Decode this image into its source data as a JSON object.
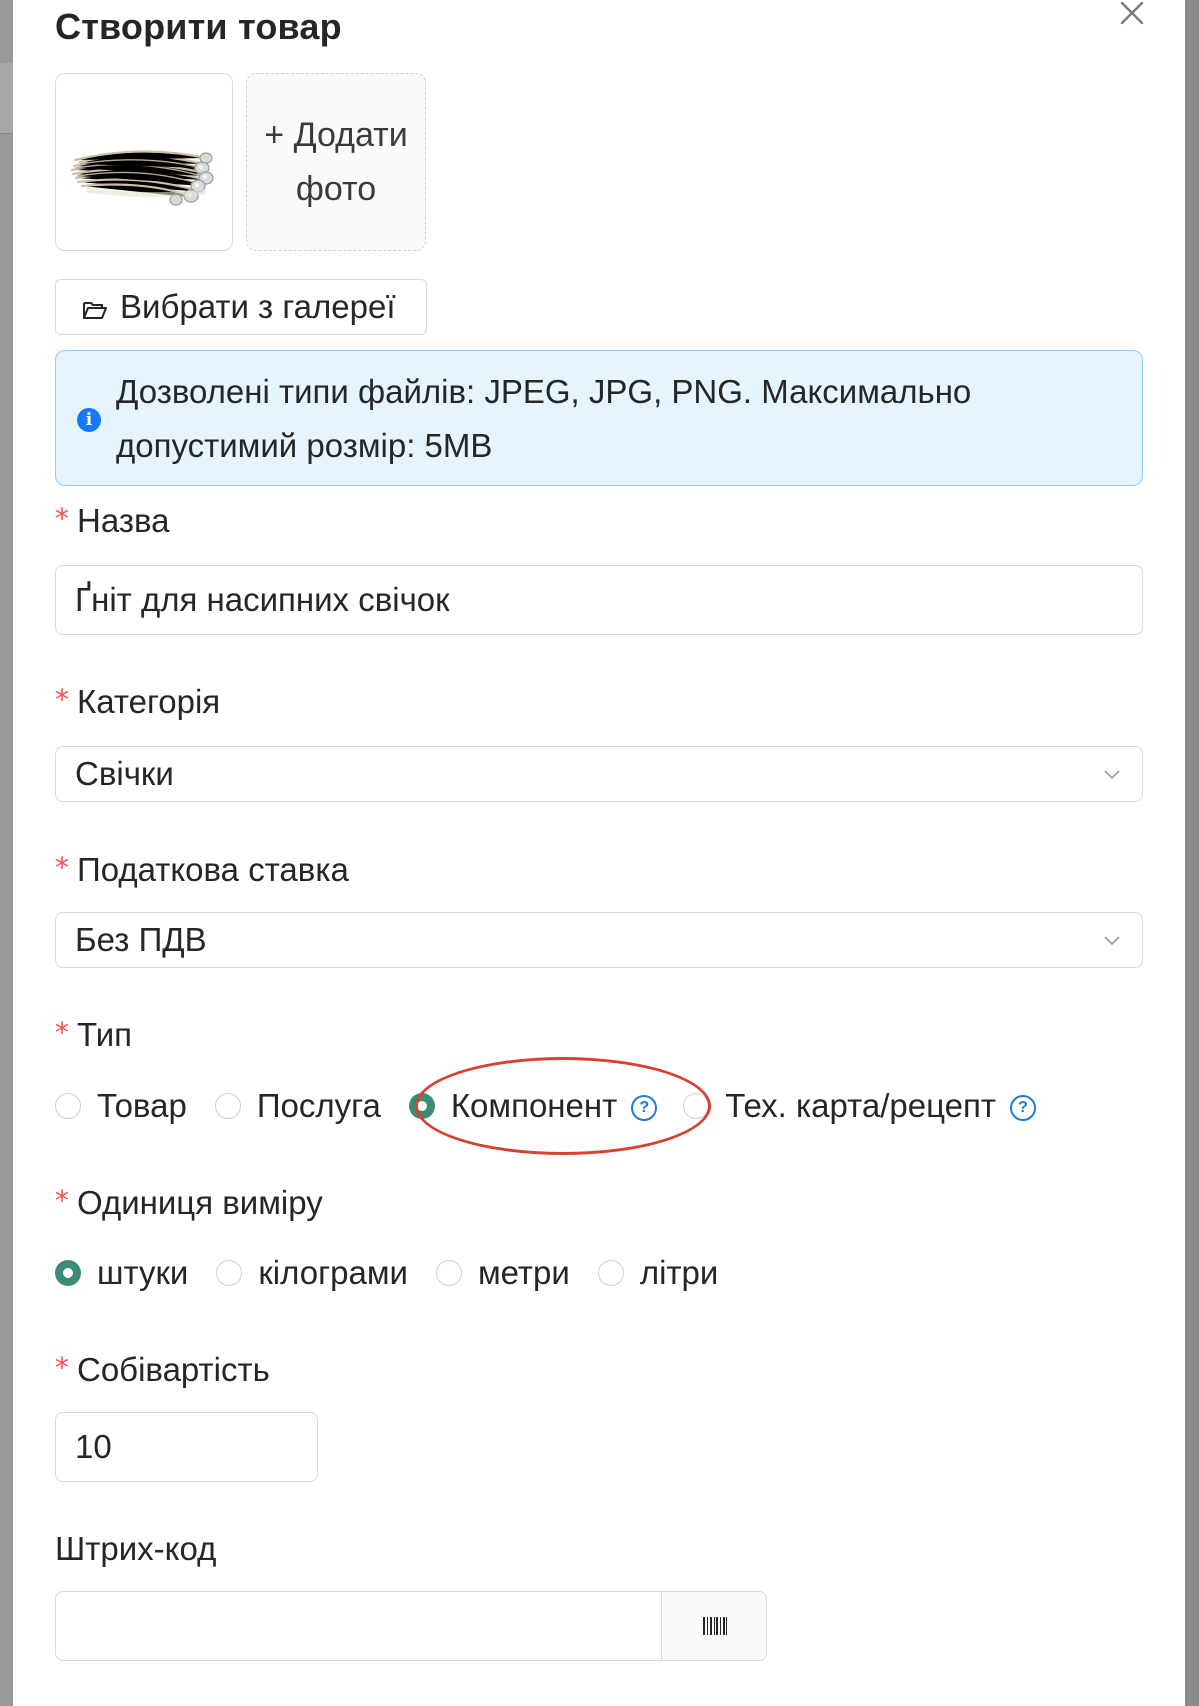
{
  "modal": {
    "title": "Створити товар"
  },
  "photos": {
    "add_label_line1": "+ Додати",
    "add_label_line2": "фото",
    "gallery_button": "Вибрати з галереї"
  },
  "info": {
    "message": "Дозволені типи файлів: JPEG, JPG, PNG. Максимально допустимий розмір: 5MB"
  },
  "fields": {
    "name": {
      "label": "Назва",
      "value": "Ґніт для насипних свічок"
    },
    "category": {
      "label": "Категорія",
      "value": "Свічки"
    },
    "tax": {
      "label": "Податкова ставка",
      "value": "Без ПДВ"
    },
    "type": {
      "label": "Тип",
      "options": [
        "Товар",
        "Послуга",
        "Компонент",
        "Тех. карта/рецепт"
      ],
      "selected": "Компонент"
    },
    "unit": {
      "label": "Одиниця виміру",
      "options": [
        "штуки",
        "кілограми",
        "метри",
        "літри"
      ],
      "selected": "штуки"
    },
    "cost": {
      "label": "Собівартість",
      "value": "10"
    },
    "barcode": {
      "label": "Штрих-код",
      "value": ""
    }
  },
  "colors": {
    "accent": "#3d8b76",
    "required": "#ff4d4f",
    "info_bg": "#e6f4ff",
    "info_border": "#91caff",
    "info_icon": "#1677ff",
    "help_icon": "#1b7bd8",
    "annotation": "#d9402f"
  },
  "icons": {
    "close": "close-icon",
    "gallery": "folder-open-icon",
    "info": "info-icon",
    "select_arrow": "chevron-down-icon",
    "help": "question-circle-icon",
    "barcode": "barcode-icon"
  }
}
